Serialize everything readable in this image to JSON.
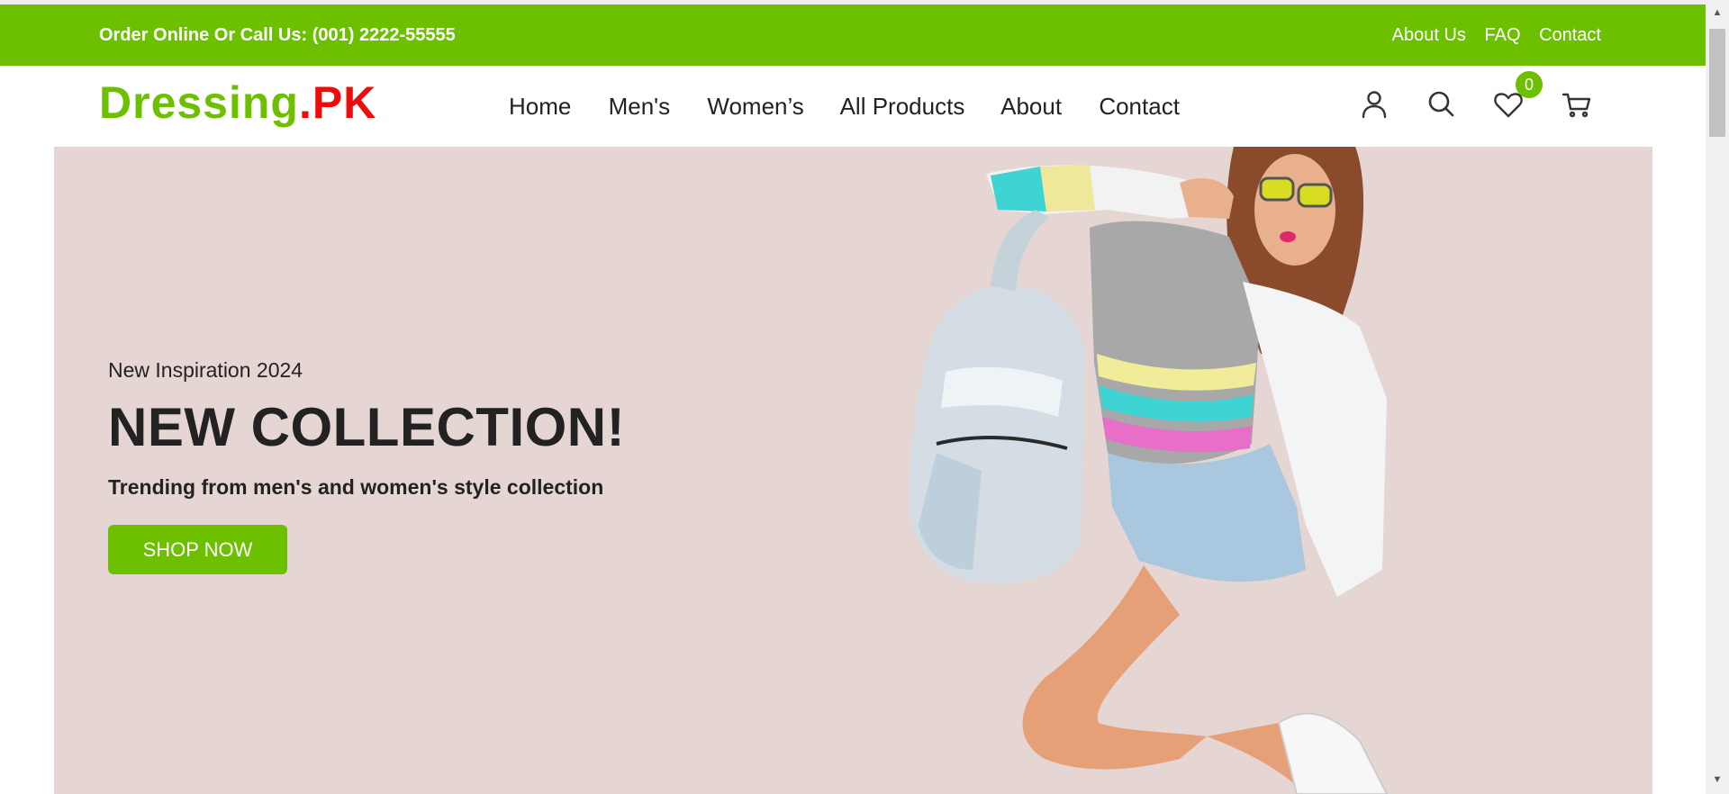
{
  "topbar": {
    "phone_text": "Order Online Or Call Us: (001) 2222-55555",
    "links": [
      "About Us",
      "FAQ",
      "Contact"
    ]
  },
  "header": {
    "logo_main": "Dressing",
    "logo_suffix": ".PK",
    "nav": [
      "Home",
      "Men's",
      "Women’s",
      "All Products",
      "About",
      "Contact"
    ],
    "icons": [
      "user-icon",
      "search-icon",
      "heart-icon",
      "cart-icon"
    ],
    "wishlist_count": "0"
  },
  "hero": {
    "eyebrow": "New Inspiration 2024",
    "headline": "NEW COLLECTION!",
    "subline": "Trending from men's and women's style collection",
    "cta": "SHOP NOW"
  },
  "colors": {
    "accent": "#6cc000",
    "logo_red": "#f00a0a",
    "hero_bg": "#e6d6d3"
  }
}
